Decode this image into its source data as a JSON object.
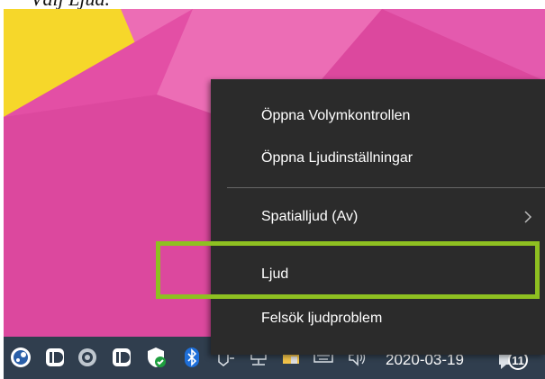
{
  "caption": {
    "text": "Välj Ljud."
  },
  "context_menu": {
    "items": [
      {
        "label": "Öppna Volymkontrollen"
      },
      {
        "label": "Öppna Ljudinställningar"
      },
      {
        "label": "Spatialljud (Av)",
        "submenu_icon": "chevron-right-icon"
      },
      {
        "label": "Ljud"
      },
      {
        "label": "Felsök ljudproblem"
      }
    ]
  },
  "taskbar": {
    "date": "2020-03-19",
    "notification_count": "11",
    "tray_icons": [
      "steam-icon",
      "id-app-icon",
      "disc-app-icon",
      "id-app-icon",
      "security-shield-icon",
      "bluetooth-icon",
      "pen-icon",
      "network-icon",
      "folder-icon",
      "keyboard-icon",
      "volume-icon"
    ]
  },
  "colors": {
    "wallpaper_pink": "#dc489e",
    "wallpaper_yellow": "#f6d72a",
    "menu_bg": "#2b2b2b",
    "taskbar_bg": "#303e4e",
    "highlight": "#8ec021"
  }
}
